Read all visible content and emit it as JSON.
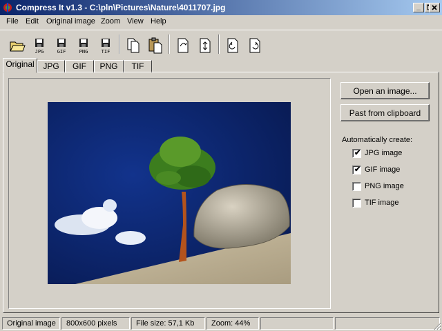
{
  "window": {
    "title": "Compress It v1.3 - C:\\pln\\Pictures\\Nature\\4011707.jpg"
  },
  "menu": [
    "File",
    "Edit",
    "Original image",
    "Zoom",
    "View",
    "Help"
  ],
  "toolbar": {
    "formats": [
      "JPG",
      "GIF",
      "PNG",
      "TIF"
    ],
    "icons": [
      "open-folder-icon",
      "save-jpg-icon",
      "save-gif-icon",
      "save-png-icon",
      "save-tif-icon",
      "copy-icon",
      "paste-icon",
      "flip-icon",
      "flip-alt-icon",
      "rotate-left-icon",
      "rotate-right-icon"
    ]
  },
  "tabs": [
    "Original",
    "JPG",
    "GIF",
    "PNG",
    "TIF"
  ],
  "active_tab": "Original",
  "buttons": {
    "open": "Open an image...",
    "paste": "Past from clipboard"
  },
  "auto": {
    "label": "Automatically create:",
    "options": [
      {
        "label": "JPG image",
        "checked": true
      },
      {
        "label": "GIF image",
        "checked": true
      },
      {
        "label": "PNG image",
        "checked": false
      },
      {
        "label": "TIF image",
        "checked": false
      }
    ]
  },
  "status": {
    "source": "Original image",
    "dimensions": "800x600 pixels",
    "filesize": "File size: 57,1 Kb",
    "zoom": "Zoom: 44%"
  },
  "colors": {
    "titlebar_start": "#0a246a",
    "titlebar_end": "#a6caf0",
    "face": "#d4d0c8"
  }
}
